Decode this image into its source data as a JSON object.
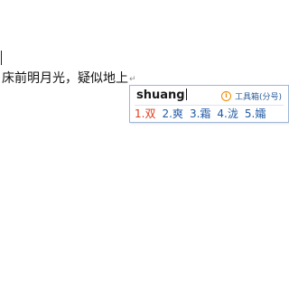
{
  "document": {
    "line_text": "床前明月光，疑似地上",
    "paragraph_mark": "↵"
  },
  "ime": {
    "pinyin": "shuang",
    "info_icon": "i",
    "toolbox_label": "工具箱(分号)",
    "candidates": [
      {
        "index": "1.",
        "text": "双"
      },
      {
        "index": "2.",
        "text": "爽"
      },
      {
        "index": "3.",
        "text": "霜"
      },
      {
        "index": "4.",
        "text": "泷"
      },
      {
        "index": "5.",
        "text": "孀"
      }
    ],
    "colors": {
      "selected_candidate": "#e03a1a",
      "candidate": "#1f5aa6",
      "border": "#9fb8d8",
      "info_icon": "#f08a00"
    }
  }
}
